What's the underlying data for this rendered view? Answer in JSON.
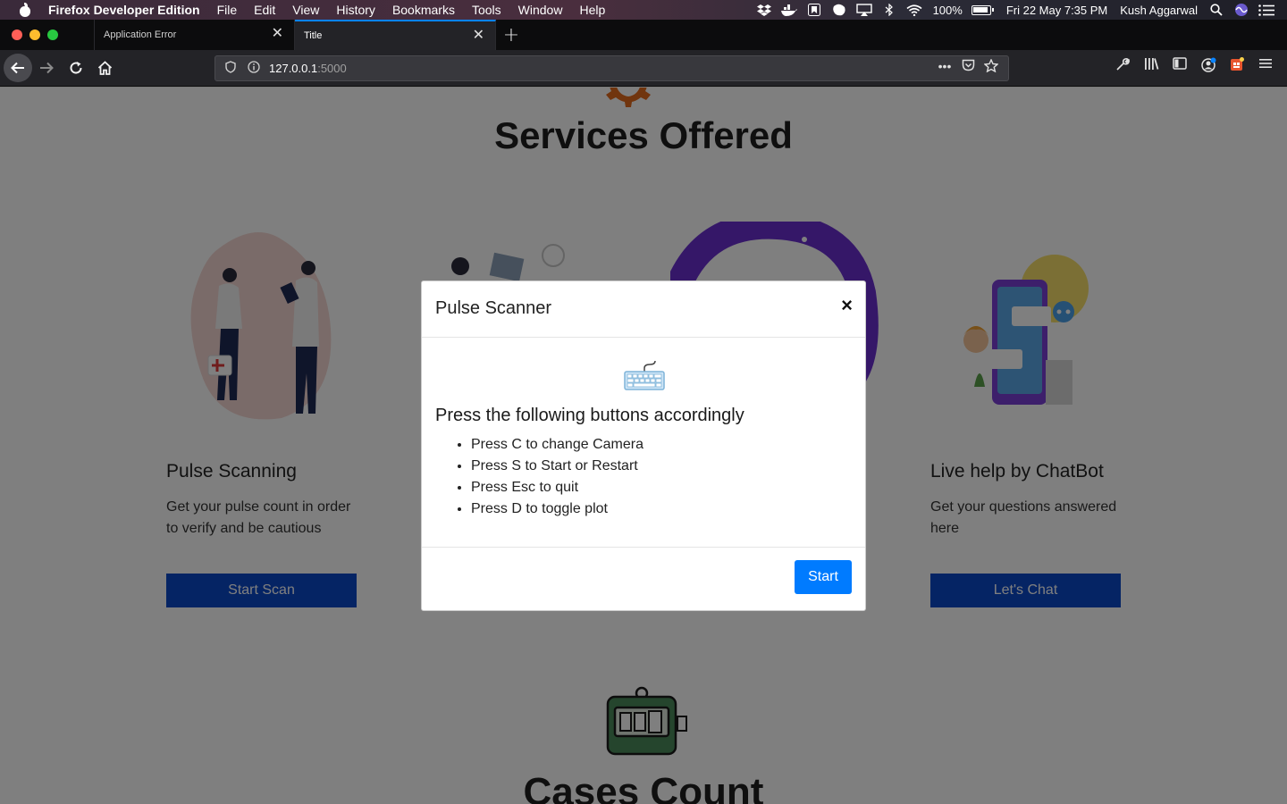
{
  "menubar": {
    "app_name": "Firefox Developer Edition",
    "menus": [
      "File",
      "Edit",
      "View",
      "History",
      "Bookmarks",
      "Tools",
      "Window",
      "Help"
    ],
    "battery": "100%",
    "datetime": "Fri 22 May  7:35 PM",
    "user": "Kush Aggarwal"
  },
  "tabs": [
    {
      "title": "Application Error",
      "active": false
    },
    {
      "title": "Title",
      "active": true
    }
  ],
  "navbar": {
    "url_host": "127.0.0.1",
    "url_port": ":5000"
  },
  "page": {
    "services_title": "Services Offered",
    "cases_title": "Cases Count",
    "cards": [
      {
        "title": "Pulse Scanning",
        "text": "Get your pulse count in order to verify and be cautious",
        "button": "Start Scan"
      },
      {
        "title": "Live help by ChatBot",
        "text": "Get your questions answered here",
        "button": "Let's Chat"
      }
    ]
  },
  "modal": {
    "title": "Pulse Scanner",
    "close": "×",
    "heading": "Press the following buttons accordingly",
    "instructions": [
      "Press C to change Camera",
      "Press S to Start or Restart",
      "Press Esc to quit",
      "Press D to toggle plot"
    ],
    "start_label": "Start"
  },
  "colors": {
    "primary_button": "#007bff",
    "card_button": "#0b49c8",
    "active_tab_accent": "#0a84ff"
  }
}
